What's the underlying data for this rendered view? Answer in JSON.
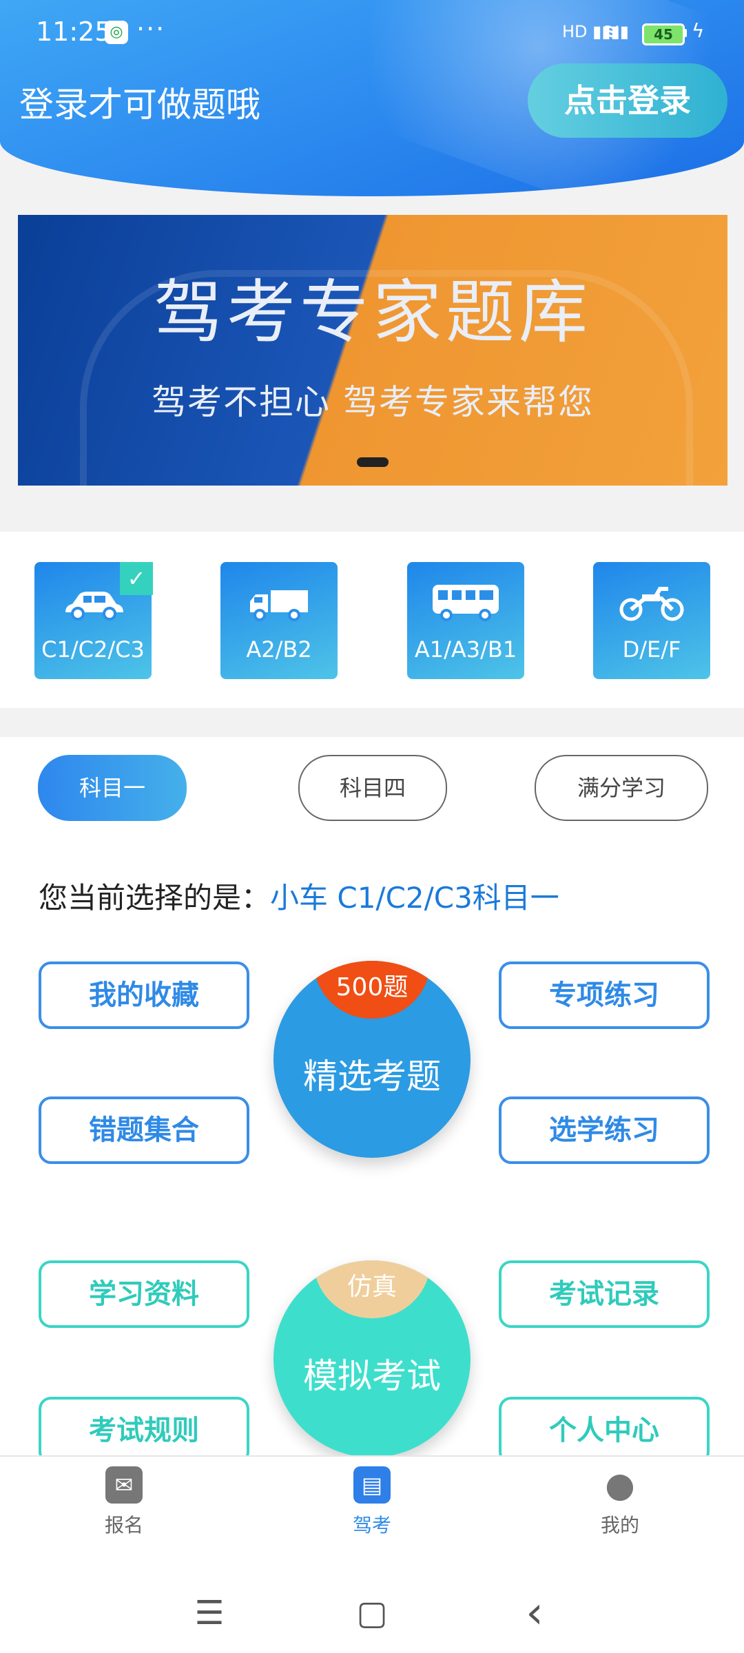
{
  "status_bar": {
    "time": "11:25",
    "dots": "···",
    "signal": "HD ▮▮▮▮",
    "battery": "45"
  },
  "header": {
    "login_hint": "登录才可做题哦",
    "login_button": "点击登录"
  },
  "banner": {
    "title": "驾考专家题库",
    "subtitle": "驾考不担心  驾考专家来帮您"
  },
  "vehicles": [
    {
      "label": "C1/C2/C3",
      "icon": "car-icon",
      "selected": true
    },
    {
      "label": "A2/B2",
      "icon": "truck-icon",
      "selected": false
    },
    {
      "label": "A1/A3/B1",
      "icon": "bus-icon",
      "selected": false
    },
    {
      "label": "D/E/F",
      "icon": "motorcycle-icon",
      "selected": false
    }
  ],
  "subjects": [
    {
      "label": "科目一",
      "active": true
    },
    {
      "label": "科目四",
      "active": false
    },
    {
      "label": "满分学习",
      "active": false
    }
  ],
  "current": {
    "prefix": "您当前选择的是：",
    "value": "小车 C1/C2/C3科目一"
  },
  "features": {
    "favorites": "我的收藏",
    "special_practice": "专项练习",
    "wrong_questions": "错题集合",
    "selective_practice": "选学练习",
    "study_materials": "学习资料",
    "exam_records": "考试记录",
    "exam_rules": "考试规则",
    "personal_center": "个人中心"
  },
  "circle_select": {
    "badge": "500题",
    "label": "精选考题"
  },
  "circle_mock": {
    "badge": "仿真",
    "label": "模拟考试"
  },
  "bottom_nav": [
    {
      "label": "报名",
      "icon": "register-icon"
    },
    {
      "label": "驾考",
      "icon": "license-card-icon"
    },
    {
      "label": "我的",
      "icon": "user-icon"
    }
  ],
  "system_nav": {
    "menu": "☰",
    "home": "▢",
    "back": "‹"
  },
  "colors": {
    "primary": "#2f8ae6",
    "teal": "#3bd5c6",
    "badge_red": "#f04e14",
    "badge_tan": "#f0ce9b"
  }
}
